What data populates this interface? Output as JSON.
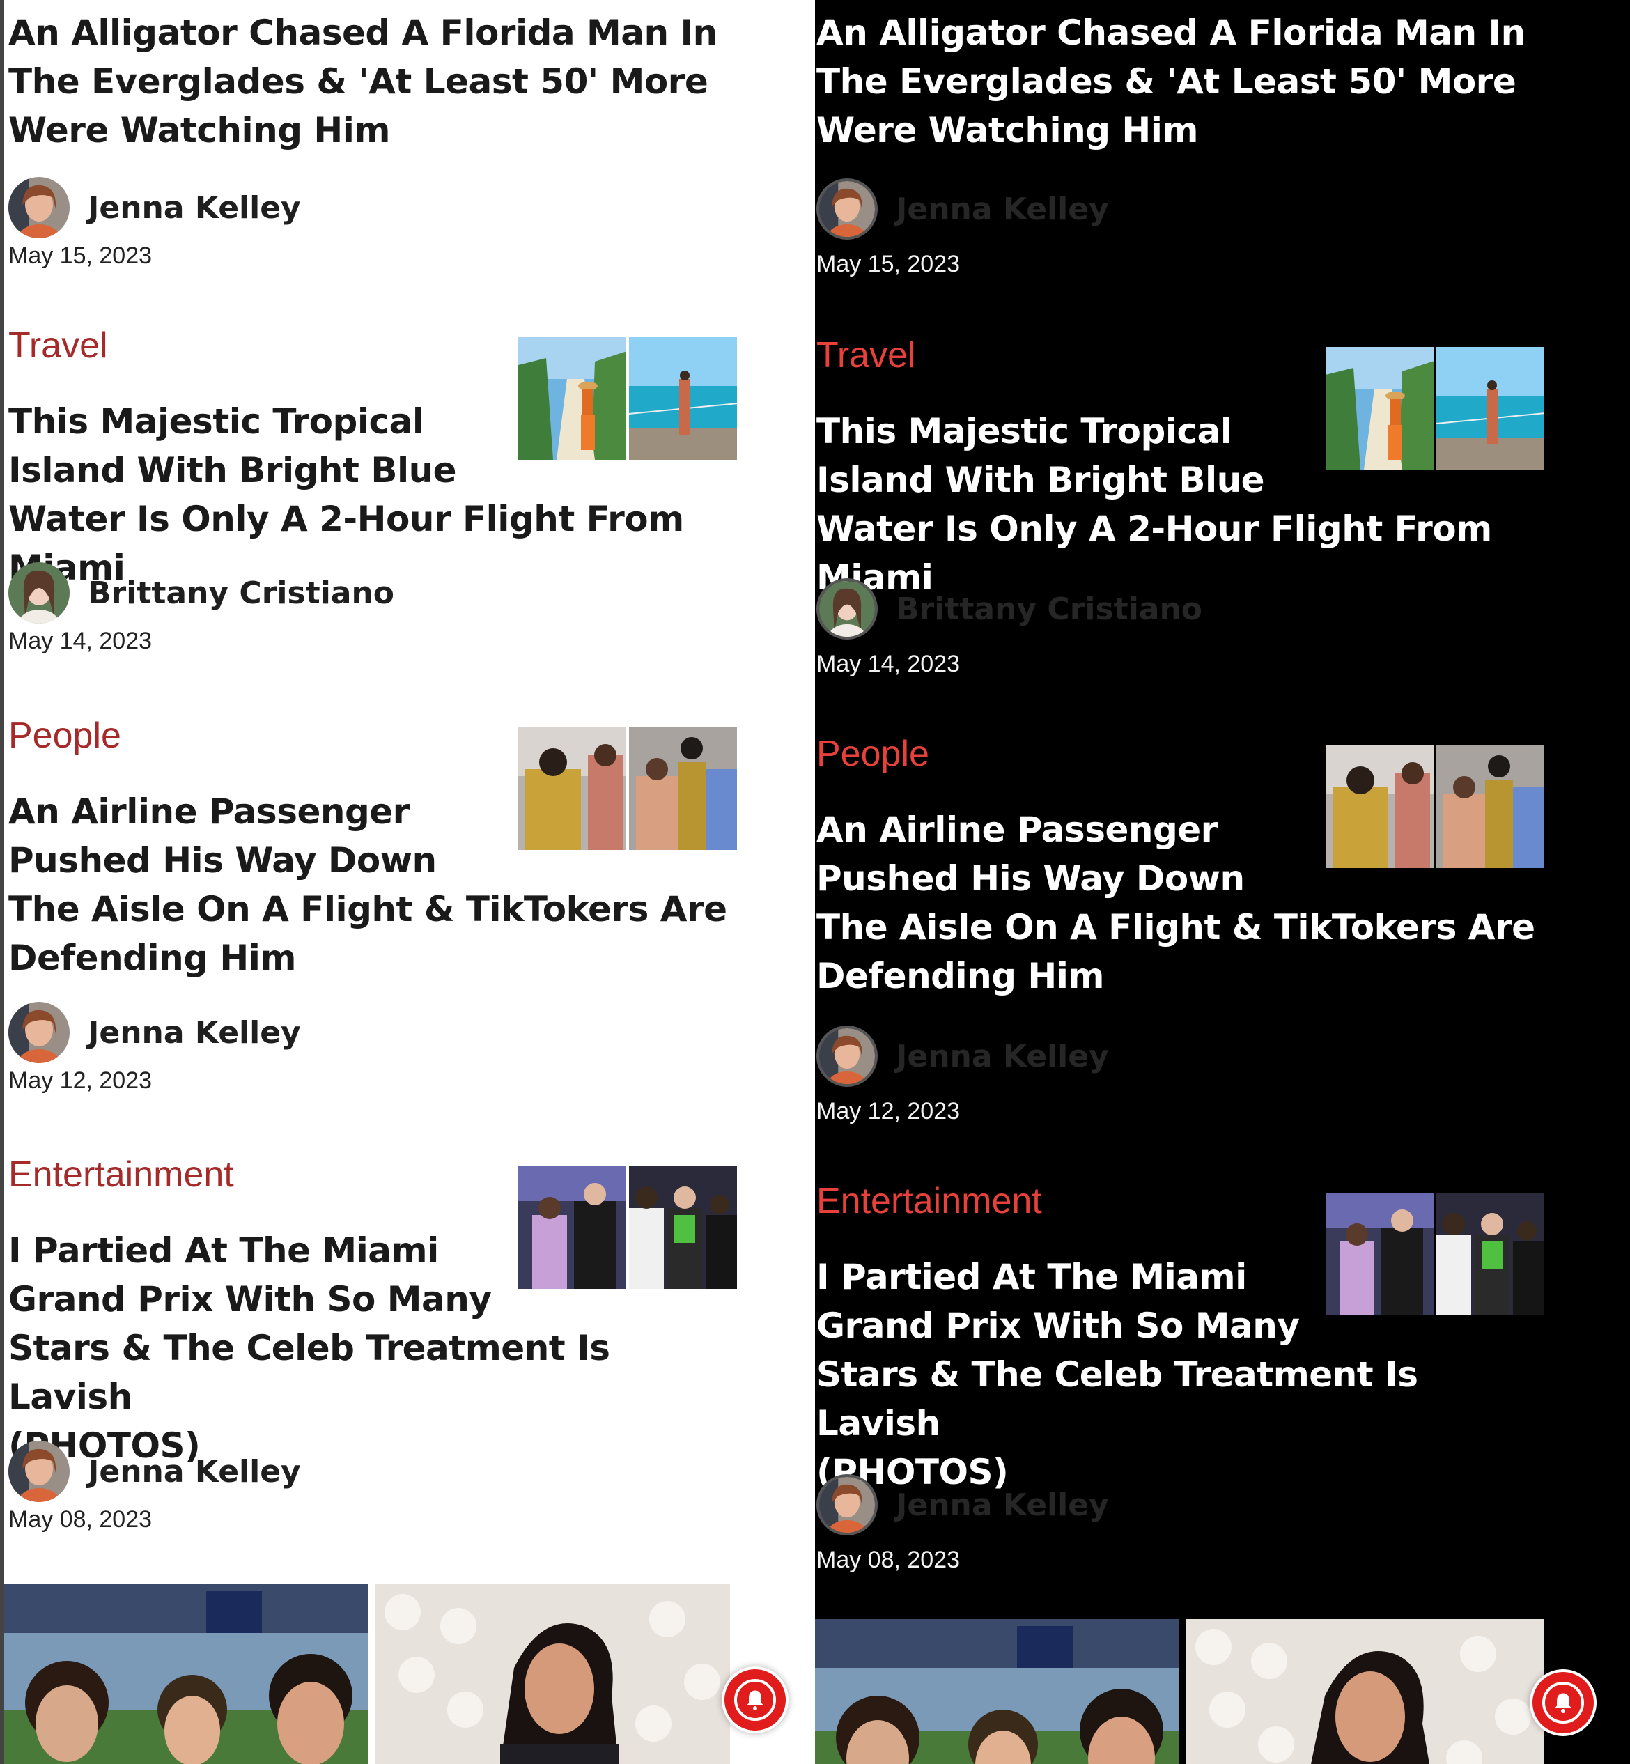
{
  "articles": [
    {
      "category": "",
      "title": "An Alligator Chased A Florida Man In The Everglades & 'At Least 50' More Were Watching Him",
      "author": "Jenna Kelley",
      "date": "May 15, 2023"
    },
    {
      "category": "Travel",
      "title_lines": [
        "This Majestic Tropical",
        "Island With Bright Blue",
        "Water Is Only A 2-Hour Flight From Miami"
      ],
      "author": "Brittany Cristiano",
      "date": "May 14, 2023"
    },
    {
      "category": "People",
      "title_lines": [
        "An Airline Passenger",
        "Pushed His Way Down",
        "The Aisle On A Flight & TikTokers Are",
        "Defending Him"
      ],
      "author": "Jenna Kelley",
      "date": "May 12, 2023"
    },
    {
      "category": "Entertainment",
      "title_lines": [
        "I Partied At The Miami",
        "Grand Prix With So Many",
        "Stars & The Celeb Treatment Is Lavish",
        "(PHOTOS)"
      ],
      "author": "Jenna Kelley",
      "date": "May 08, 2023"
    }
  ],
  "colors": {
    "light_category": "#a52a2a",
    "dark_category": "#e8403a",
    "bell": "#e11c1c"
  },
  "icons": {
    "notification": "bell-icon"
  }
}
